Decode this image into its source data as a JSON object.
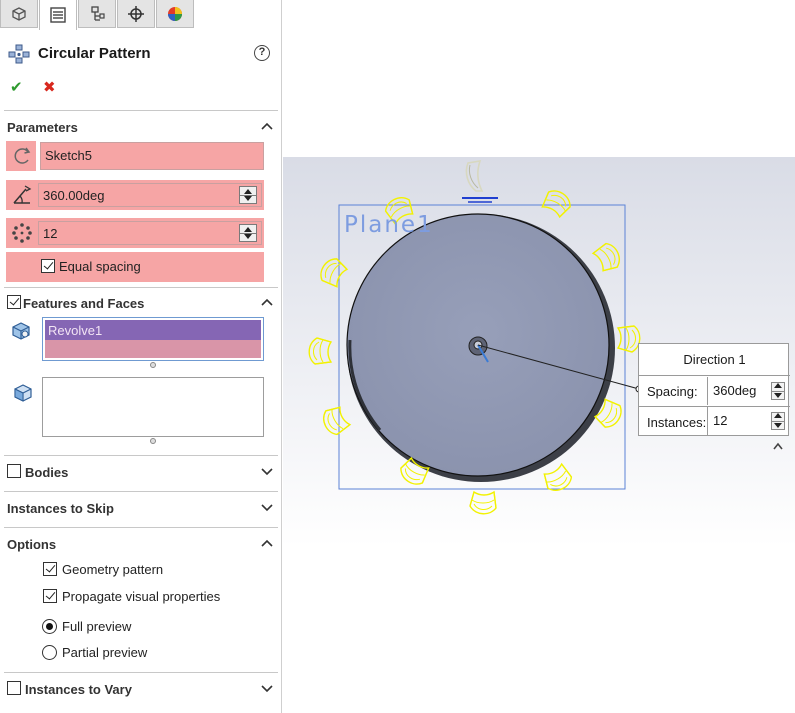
{
  "panel": {
    "title": "Circular Pattern",
    "help_glyph": "?",
    "ok_glyph": "✔",
    "cancel_glyph": "✖",
    "tabs": [
      {
        "icon": "feature-manager-icon",
        "active": false
      },
      {
        "icon": "property-manager-icon",
        "active": true
      },
      {
        "icon": "configuration-manager-icon",
        "active": false
      },
      {
        "icon": "dimxpert-manager-icon",
        "active": false
      },
      {
        "icon": "display-manager-icon",
        "active": false
      }
    ],
    "parameters": {
      "label": "Parameters",
      "axis_value": "Sketch5",
      "angle_value": "360.00deg",
      "instances_value": "12",
      "equal_spacing_label": "Equal spacing",
      "equal_spacing_checked": true
    },
    "features_and_faces": {
      "label": "Features and Faces",
      "checked": true,
      "features_list": [
        "Revolve1"
      ],
      "faces_list": []
    },
    "bodies": {
      "label": "Bodies",
      "checked": false
    },
    "instances_to_skip": {
      "label": "Instances to Skip"
    },
    "options": {
      "label": "Options",
      "geometry_pattern_label": "Geometry pattern",
      "geometry_pattern_checked": true,
      "propagate_label": "Propagate visual properties",
      "propagate_checked": true,
      "full_preview_label": "Full preview",
      "partial_preview_label": "Partial preview",
      "selected_preview": "Full preview"
    },
    "instances_to_vary": {
      "label": "Instances to Vary",
      "checked": false
    }
  },
  "viewport": {
    "plane_label": "Plane1",
    "colors": {
      "background_bottom": "#ffffff",
      "background_top": "#d9dce6",
      "disk": "#8f97b2",
      "preview": "#f2f200",
      "plane": "#5b82d6",
      "selection_pink": "#f6a5a5",
      "selection_purple": "#8566b4"
    },
    "callout": {
      "title": "Direction 1",
      "spacing_label": "Spacing:",
      "spacing_value": "360deg",
      "instances_label": "Instances:",
      "instances_value": "12"
    }
  }
}
